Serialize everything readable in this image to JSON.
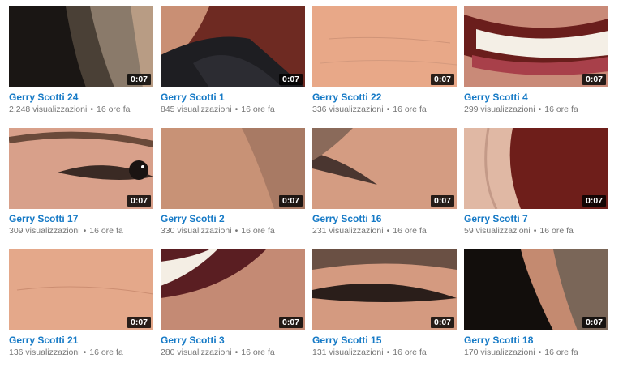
{
  "videos": [
    {
      "title": "Gerry Scotti 24",
      "views": "2.248 visualizzazioni",
      "age": "16 ore fa",
      "duration": "0:07"
    },
    {
      "title": "Gerry Scotti 1",
      "views": "845 visualizzazioni",
      "age": "16 ore fa",
      "duration": "0:07"
    },
    {
      "title": "Gerry Scotti 22",
      "views": "336 visualizzazioni",
      "age": "16 ore fa",
      "duration": "0:07"
    },
    {
      "title": "Gerry Scotti 4",
      "views": "299 visualizzazioni",
      "age": "16 ore fa",
      "duration": "0:07"
    },
    {
      "title": "Gerry Scotti 17",
      "views": "309 visualizzazioni",
      "age": "16 ore fa",
      "duration": "0:07"
    },
    {
      "title": "Gerry Scotti 2",
      "views": "330 visualizzazioni",
      "age": "16 ore fa",
      "duration": "0:07"
    },
    {
      "title": "Gerry Scotti 16",
      "views": "231 visualizzazioni",
      "age": "16 ore fa",
      "duration": "0:07"
    },
    {
      "title": "Gerry Scotti 7",
      "views": "59 visualizzazioni",
      "age": "16 ore fa",
      "duration": "0:07"
    },
    {
      "title": "Gerry Scotti 21",
      "views": "136 visualizzazioni",
      "age": "16 ore fa",
      "duration": "0:07"
    },
    {
      "title": "Gerry Scotti 3",
      "views": "280 visualizzazioni",
      "age": "16 ore fa",
      "duration": "0:07"
    },
    {
      "title": "Gerry Scotti 15",
      "views": "131 visualizzazioni",
      "age": "16 ore fa",
      "duration": "0:07"
    },
    {
      "title": "Gerry Scotti 18",
      "views": "170 visualizzazioni",
      "age": "16 ore fa",
      "duration": "0:07"
    }
  ],
  "meta_separator": "•"
}
